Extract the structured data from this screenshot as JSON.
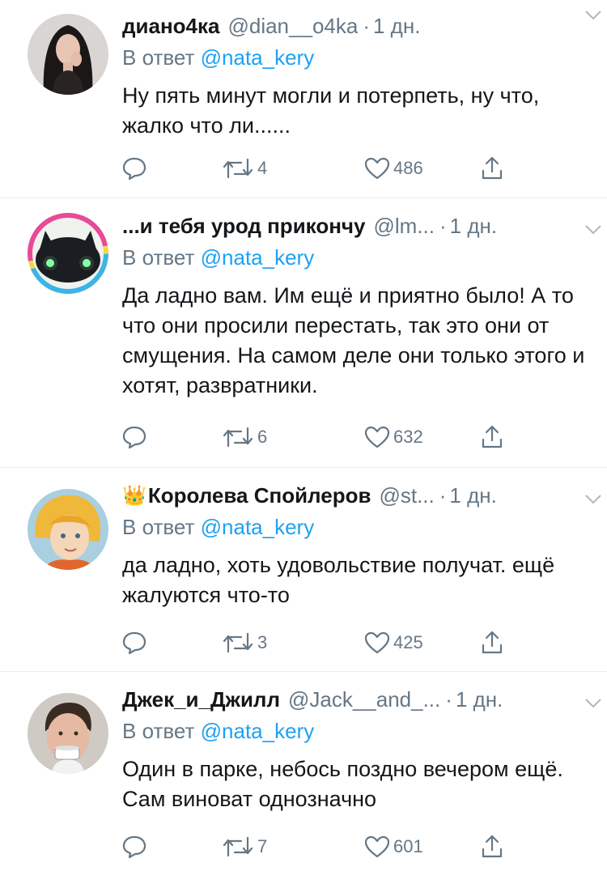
{
  "tweets": [
    {
      "name": "диано4ка",
      "crown": "",
      "handle": "@dian__o4ka",
      "time": "1 дн.",
      "reply_prefix": "В ответ",
      "reply_to": "@nata_kery",
      "text": "Ну пять минут могли и потерпеть, ну что, жалко что ли......",
      "retweets": "4",
      "likes": "486"
    },
    {
      "name": "...и тебя урод прикончу",
      "crown": "",
      "handle": "@lm...",
      "time": "1 дн.",
      "reply_prefix": "В ответ",
      "reply_to": "@nata_kery",
      "text": "Да ладно вам. Им ещё и приятно было! А то что они просили перестать, так это они от смущения. На самом деле они только этого и хотят, развратники.",
      "retweets": "6",
      "likes": "632"
    },
    {
      "name": "Королева Спойлеров",
      "crown": "👑",
      "handle": "@st...",
      "time": "1 дн.",
      "reply_prefix": "В ответ",
      "reply_to": "@nata_kery",
      "text": "да ладно, хоть удовольствие получат. ещё жалуются что-то",
      "retweets": "3",
      "likes": "425"
    },
    {
      "name": "Джек_и_Джилл",
      "crown": "",
      "handle": "@Jack__and_...",
      "time": "1 дн.",
      "reply_prefix": "В ответ",
      "reply_to": "@nata_kery",
      "text": "Один в парке, небось поздно вечером ещё. Сам виноват однозначно",
      "retweets": "7",
      "likes": "601"
    }
  ],
  "icons": {
    "reply": "reply-icon",
    "retweet": "retweet-icon",
    "like": "heart-icon",
    "share": "share-icon",
    "menu": "chevron-down-icon"
  },
  "colors": {
    "link": "#1da1f2",
    "secondary": "#657786",
    "text": "#14171a",
    "divider": "#e6ecf0"
  }
}
